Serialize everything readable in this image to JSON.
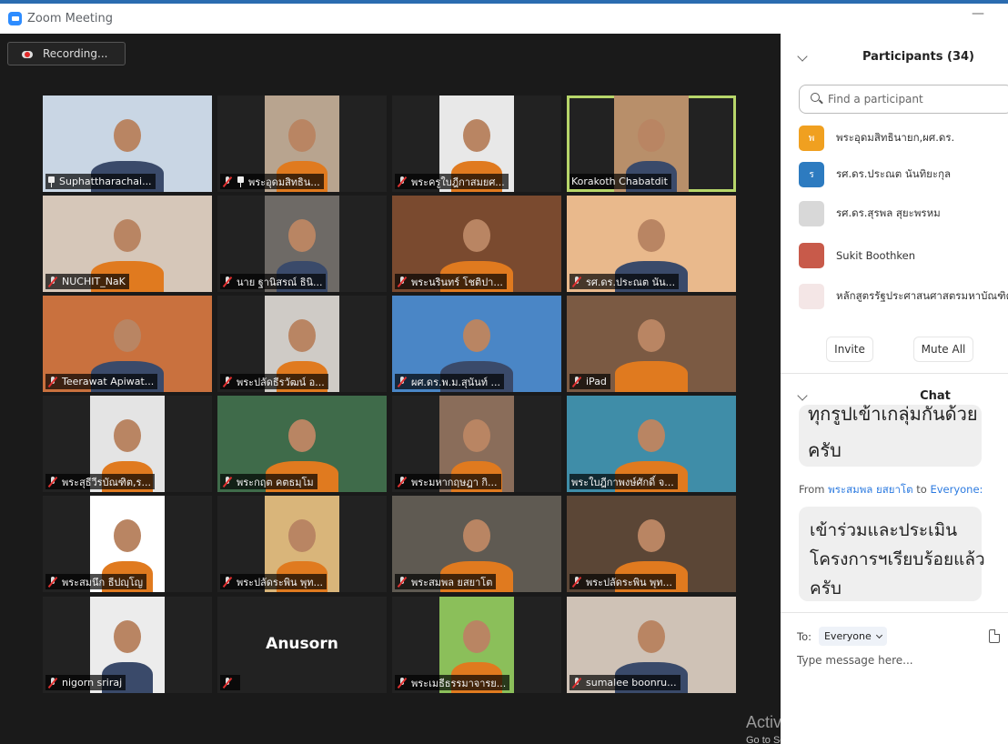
{
  "window": {
    "title": "Zoom Meeting",
    "minimize_glyph": "—"
  },
  "recording": {
    "label": "Recording..."
  },
  "tiles": [
    {
      "name": "Suphattharachai...",
      "muted": false,
      "pinned": true,
      "bg": "#c9d6e4",
      "active": false
    },
    {
      "name": "พระอุดมสิทธิน...",
      "muted": true,
      "pinned": true,
      "bg": "#b8a48f",
      "active": false
    },
    {
      "name": "พระครูใบฎีกาสมยศ...",
      "muted": true,
      "pinned": false,
      "bg": "#e8e8e8",
      "active": false
    },
    {
      "name": "Korakoth Chabatdit",
      "muted": false,
      "pinned": false,
      "bg": "#b88f6a",
      "active": true
    },
    {
      "name": "NUCHIT_NaK",
      "muted": true,
      "pinned": false,
      "bg": "#d6c7b9",
      "active": false
    },
    {
      "name": "นาย ฐานิสรณ์ ธินิ...",
      "muted": true,
      "pinned": false,
      "bg": "#6e6a66",
      "active": false
    },
    {
      "name": "พระนรินทร์ โชติปา...",
      "muted": true,
      "pinned": false,
      "bg": "#7a4a2f",
      "active": false
    },
    {
      "name": "รศ.ดร.ประณต นัน...",
      "muted": true,
      "pinned": false,
      "bg": "#e9b98c",
      "active": false
    },
    {
      "name": "Teerawat Apiwat...",
      "muted": true,
      "pinned": false,
      "bg": "#c9713e",
      "active": false
    },
    {
      "name": "พระปลัดธีรวัฒน์ อ...",
      "muted": true,
      "pinned": false,
      "bg": "#cfcbc6",
      "active": false
    },
    {
      "name": "ผศ.ดร.พ.ม.สุนันท์ ...",
      "muted": true,
      "pinned": false,
      "bg": "#4a86c6",
      "active": false
    },
    {
      "name": "iPad",
      "muted": true,
      "pinned": false,
      "bg": "#7b5a43",
      "active": false
    },
    {
      "name": "พระสุธีวีรบัณฑิต,ร...",
      "muted": true,
      "pinned": false,
      "bg": "#e4e4e4",
      "active": false
    },
    {
      "name": "พระกฤต คตธมฺโม",
      "muted": true,
      "pinned": false,
      "bg": "#3f6b4a",
      "active": false
    },
    {
      "name": "พระมหากฤษฎา กิ...",
      "muted": true,
      "pinned": false,
      "bg": "#8a6d5a",
      "active": false
    },
    {
      "name": "พระใบฎีกาพงษ์ศักดิ์ จ...",
      "muted": false,
      "pinned": false,
      "bg": "#3f8da8",
      "active": false
    },
    {
      "name": "พระสมนึก ธีปญฺโญ",
      "muted": true,
      "pinned": false,
      "bg": "#ffffff",
      "active": false
    },
    {
      "name": "พระปลัดระพิน พุท...",
      "muted": true,
      "pinned": false,
      "bg": "#d9b57a",
      "active": false
    },
    {
      "name": "พระสมพล ยสยาโต",
      "muted": true,
      "pinned": false,
      "bg": "#5f5a52",
      "active": false
    },
    {
      "name": "พระปลัดระพิน พุท...",
      "muted": true,
      "pinned": false,
      "bg": "#5b4636",
      "active": false
    },
    {
      "name": "nigorn sriraj",
      "muted": true,
      "pinned": false,
      "bg": "#ececec",
      "active": false
    },
    {
      "name": "",
      "muted": true,
      "pinned": false,
      "bg": "#222222",
      "active": false,
      "big_name": "Anusorn"
    },
    {
      "name": "พระเมธีธรรมาจารย...",
      "muted": true,
      "pinned": false,
      "bg": "#8bbf5a",
      "active": false
    },
    {
      "name": "sumalee boonru...",
      "muted": true,
      "pinned": false,
      "bg": "#cfc2b6",
      "active": false
    }
  ],
  "sidebar": {
    "participants_title": "Participants (34)",
    "search_placeholder": "Find a participant",
    "participants": [
      {
        "name": "พระอุดมสิทธินายก,ผศ.ดร.",
        "avatar_letter": "พ",
        "avatar_color": "#f0a020"
      },
      {
        "name": "รศ.ดร.ประณต  นันทิยะกุล",
        "avatar_letter": "ร",
        "avatar_color": "#2d7bc0"
      },
      {
        "name": "รศ.ดร.สุรพล สุยะพรหม",
        "avatar_letter": "",
        "avatar_color": "#d8d8d8"
      },
      {
        "name": "Sukit  Boothken",
        "avatar_letter": "",
        "avatar_color": "#c85a4a"
      },
      {
        "name": "หลักสูตรรัฐประศาสนศาสตรมหาบัณฑิต",
        "avatar_letter": "",
        "avatar_color": "#f4e6e6"
      }
    ],
    "invite_label": "Invite",
    "mute_all_label": "Mute All",
    "chat_title": "Chat",
    "chat_message1_line1": "ทุกรูปเข้าเกลุ่มกันด้วย",
    "chat_message1_line2": "ครับ",
    "chat_from_prefix": "From ",
    "chat_from_sender": "พระสมพล ยสยาโต",
    "chat_from_mid": " to ",
    "chat_from_target": "Everyone:",
    "chat_message2_lines": [
      "เข้าร่วมและประเมิน",
      "โครงการฯเรียบร้อยแล้ว",
      "ครับ"
    ],
    "to_label": "To:",
    "to_value": "Everyone",
    "message_placeholder": "Type message here..."
  },
  "os_watermark": {
    "line1": "Activate Windows",
    "line2": "Go to Settings to activate Windows."
  }
}
